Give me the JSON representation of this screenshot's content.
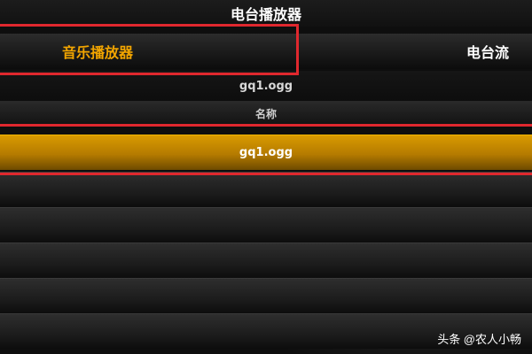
{
  "window": {
    "title": "电台播放器"
  },
  "tabs": [
    {
      "label": "音乐播放器",
      "active": true
    },
    {
      "label": "电台流",
      "active": false
    }
  ],
  "now_playing": {
    "file": "gq1.ogg"
  },
  "list": {
    "column_header": "名称",
    "items": [
      {
        "name": "gq1.ogg",
        "selected": true
      },
      {
        "name": "",
        "selected": false
      },
      {
        "name": "",
        "selected": false
      },
      {
        "name": "",
        "selected": false
      },
      {
        "name": "",
        "selected": false
      },
      {
        "name": "",
        "selected": false
      }
    ]
  },
  "colors": {
    "accent": "#f2a500",
    "highlight_annotation": "#e0282e",
    "selected_row": "#c88a00"
  },
  "watermark": "头条 @农人小畅"
}
